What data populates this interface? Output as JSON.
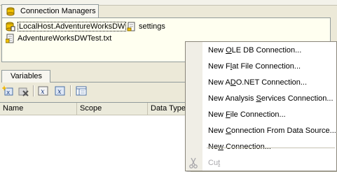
{
  "connection_managers": {
    "tab_label": "Connection Managers",
    "items": [
      {
        "label": "LocalHost.AdventureWorksDW",
        "icon": "database-connection-icon"
      },
      {
        "label": "settings",
        "icon": "file-connection-icon"
      },
      {
        "label": "AdventureWorksDWTest.txt",
        "icon": "flat-file-icon"
      }
    ]
  },
  "variables": {
    "tab_label": "Variables",
    "toolbar": [
      "add-variable-icon",
      "delete-variable-icon",
      "show-system-variables-icon",
      "show-all-variables-icon",
      "choose-columns-icon"
    ],
    "columns": [
      "Name",
      "Scope",
      "Data Type"
    ]
  },
  "context_menu": {
    "items": [
      {
        "pre": "New ",
        "key": "O",
        "post": "LE DB Connection...",
        "enabled": true
      },
      {
        "pre": "New F",
        "key": "l",
        "post": "at File Connection...",
        "enabled": true
      },
      {
        "pre": "New A",
        "key": "D",
        "post": "O.NET Connection...",
        "enabled": true
      },
      {
        "pre": "New Analysis ",
        "key": "S",
        "post": "ervices Connection...",
        "enabled": true
      },
      {
        "pre": "New ",
        "key": "F",
        "post": "ile Connection...",
        "enabled": true
      },
      {
        "pre": "New ",
        "key": "C",
        "post": "onnection From Data Source...",
        "enabled": true
      },
      {
        "pre": "Ne",
        "key": "w",
        "post": " Connection...",
        "enabled": true
      },
      {
        "pre": "Cu",
        "key": "t",
        "post": "",
        "enabled": false,
        "icon": "scissors-icon"
      }
    ]
  },
  "colors": {
    "background": "#ece9d8",
    "panel": "#fffff0",
    "menu": "#ffffff",
    "disabled_text": "#a7a6aa",
    "border": "#919b9c"
  }
}
